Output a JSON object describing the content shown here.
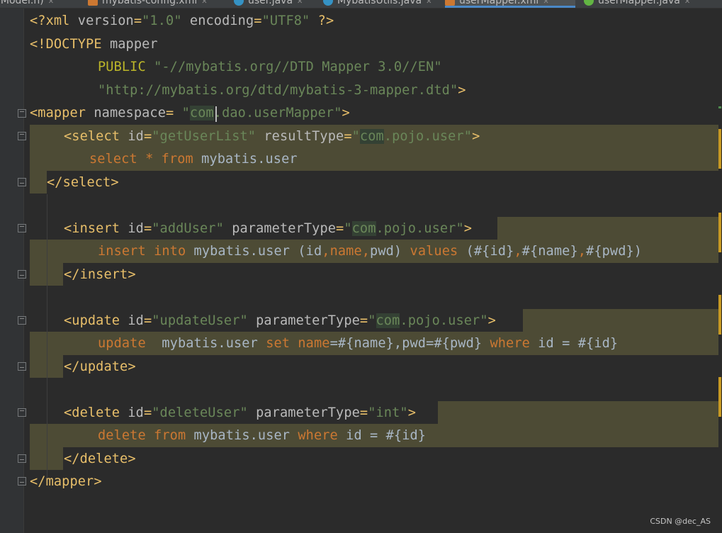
{
  "tabs": [
    {
      "label": "nModel.h)",
      "icon": "none"
    },
    {
      "label": "mybatis-config.xml",
      "icon": "xml-file-icon"
    },
    {
      "label": "user.java",
      "icon": "java-class-icon"
    },
    {
      "label": "MybatisUtils.java",
      "icon": "java-class-icon"
    },
    {
      "label": "userMapper.xml",
      "icon": "xml-file-icon",
      "active": true
    },
    {
      "label": "userMapper.java",
      "icon": "java-interface-icon"
    }
  ],
  "colors": {
    "background": "#2b2b2b",
    "tag": "#e8bf6a",
    "attribute": "#bababa",
    "string": "#6a8759",
    "sql_keyword": "#cc7832",
    "text": "#a9b7c6",
    "highlight": "#4d4b35",
    "active_tab_underline": "#4a88c7"
  },
  "code": {
    "l1": {
      "t1": "<?xml ",
      "a1": "version",
      "t2": "=",
      "s1": "\"1.0\"",
      "a2": " encoding",
      "t3": "=",
      "s2": "\"UTF8\"",
      "t4": " ?>"
    },
    "l2": {
      "t1": "<!DOCTYPE ",
      "a1": "mapper"
    },
    "l3": {
      "p1": "PUBLIC ",
      "s1": "\"-//mybatis.org//DTD Mapper 3.0//EN\""
    },
    "l4": {
      "s1": "\"http://mybatis.org/dtd/mybatis-3-mapper.dtd\"",
      "t1": ">"
    },
    "l5": {
      "t1": "<mapper ",
      "a1": "namespace",
      "t2": "= ",
      "s1": "\"",
      "s2": "com",
      "s3": ".dao.userMapper\"",
      "t3": ">"
    },
    "l6": {
      "t1": "<select ",
      "a1": "id",
      "t2": "=",
      "s1": "\"getUserList\"",
      "a2": " resultType",
      "t3": "=",
      "s2": "\"",
      "s3": "com",
      "s4": ".pojo.user\"",
      "t4": ">"
    },
    "l7": {
      "k1": "select ",
      "k2": "* ",
      "k3": "from ",
      "d1": "mybatis.user"
    },
    "l8": {
      "t1": "</select>"
    },
    "l9": {
      "t1": "<insert ",
      "a1": "id",
      "t2": "=",
      "s1": "\"addUser\"",
      "a2": " parameterType",
      "t3": "=",
      "s2": "\"",
      "s3": "com",
      "s4": ".pojo.user\"",
      "t4": ">"
    },
    "l10": {
      "k1": "insert ",
      "k2": "into ",
      "d1": "mybatis.user (id",
      "k3": ",",
      "d2": "name",
      "k4": ",",
      "d3": "pwd) ",
      "k5": "values ",
      "d4": "(#{id}",
      "k6": ",",
      "d5": "#{name}",
      "k7": ",",
      "d6": "#{pwd})"
    },
    "l11": {
      "t1": "</insert>"
    },
    "l12": {
      "t1": "<update ",
      "a1": "id",
      "t2": "=",
      "s1": "\"updateUser\"",
      "a2": " parameterType",
      "t3": "=",
      "s2": "\"",
      "s3": "com",
      "s4": ".pojo.user\"",
      "t4": ">"
    },
    "l13": {
      "k1": "update  ",
      "d1": "mybatis.user ",
      "k2": "set ",
      "k3": "name",
      "d2": "=#{name},pwd=#{pwd} ",
      "k4": "where ",
      "d3": "id = #{id}"
    },
    "l14": {
      "t1": "</update>"
    },
    "l15": {
      "t1": "<delete ",
      "a1": "id",
      "t2": "=",
      "s1": "\"deleteUser\"",
      "a2": " parameterType",
      "t3": "=",
      "s2": "\"int\"",
      "t4": ">"
    },
    "l16": {
      "k1": "delete ",
      "k2": "from ",
      "d1": "mybatis.user ",
      "k3": "where ",
      "d2": "id = #{id}"
    },
    "l17": {
      "t1": "</delete>"
    },
    "l18": {
      "t1": "</mapper>"
    }
  },
  "watermark": "CSDN @dec_AS"
}
